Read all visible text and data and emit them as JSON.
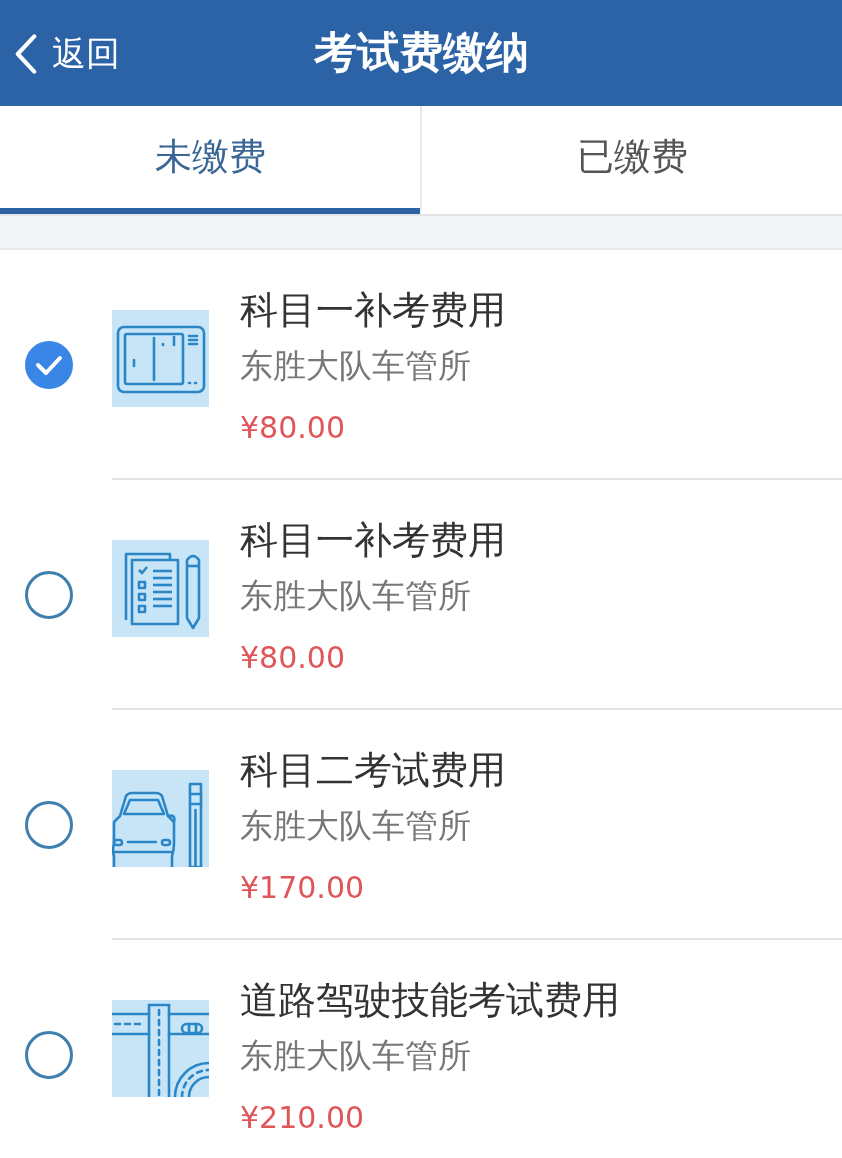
{
  "header": {
    "back_label": "返回",
    "title": "考试费缴纳"
  },
  "tabs": [
    {
      "label": "未缴费",
      "selected": true
    },
    {
      "label": "已缴费",
      "selected": false
    }
  ],
  "items": [
    {
      "title": "科目一补考费用",
      "office": "东胜大队车管所",
      "price": "¥80.00",
      "selected": true
    },
    {
      "title": "科目一补考费用",
      "office": "东胜大队车管所",
      "price": "¥80.00",
      "selected": false
    },
    {
      "title": "科目二考试费用",
      "office": "东胜大队车管所",
      "price": "¥170.00",
      "selected": false
    },
    {
      "title": "道路驾驶技能考试费用",
      "office": "东胜大队车管所",
      "price": "¥210.00",
      "selected": false
    }
  ]
}
